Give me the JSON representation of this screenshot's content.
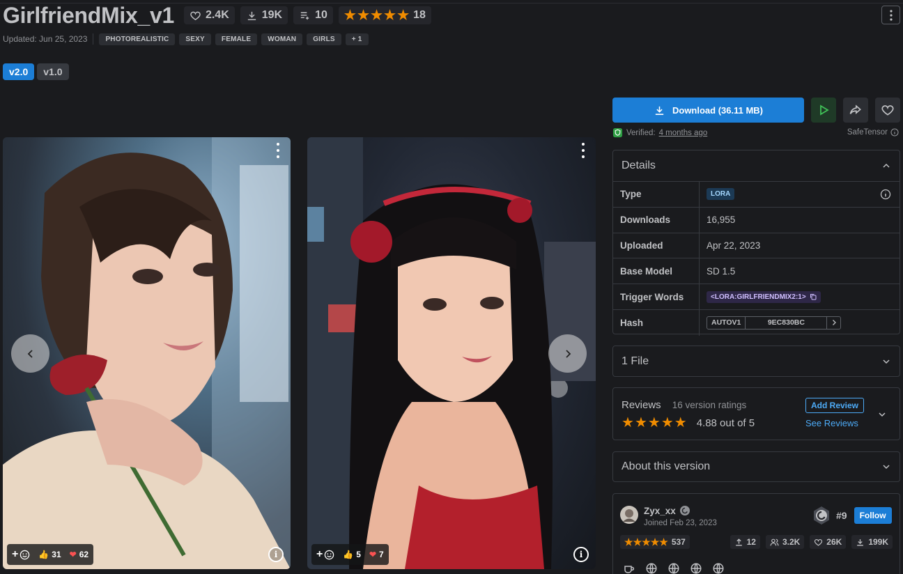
{
  "header": {
    "title": "GirlfriendMix_v1",
    "likes": "2.4K",
    "downloads": "19K",
    "collections": "10",
    "rating_count": "18"
  },
  "meta": {
    "updated": "Updated: Jun 25, 2023",
    "tags": [
      "PHOTOREALISTIC",
      "SEXY",
      "FEMALE",
      "WOMAN",
      "GIRLS"
    ],
    "more_tags": "+ 1"
  },
  "versions": [
    {
      "label": "v2.0",
      "active": true
    },
    {
      "label": "v1.0",
      "active": false
    }
  ],
  "gallery": [
    {
      "thumbs": "31",
      "hearts": "62"
    },
    {
      "thumbs": "5",
      "hearts": "7"
    }
  ],
  "download": {
    "label": "Download (36.11 MB)",
    "verified_prefix": "Verified:",
    "verified_time": "4 months ago",
    "format": "SafeTensor"
  },
  "details": {
    "title": "Details",
    "rows": [
      {
        "key": "Type",
        "value": "LORA"
      },
      {
        "key": "Downloads",
        "value": "16,955"
      },
      {
        "key": "Uploaded",
        "value": "Apr 22, 2023"
      },
      {
        "key": "Base Model",
        "value": "SD 1.5"
      },
      {
        "key": "Trigger Words",
        "value": "<LORA:GIRLFRIENDMIX2:1>"
      },
      {
        "key": "Hash",
        "value": "AUTOV1",
        "hash": "9EC830BC"
      }
    ]
  },
  "files": {
    "title": "1 File"
  },
  "reviews": {
    "title": "Reviews",
    "sub": "16 version ratings",
    "score": "4.88 out of 5",
    "add": "Add Review",
    "see": "See Reviews"
  },
  "about": {
    "title": "About this version"
  },
  "creator": {
    "name": "Zyx_xx",
    "joined": "Joined Feb 23, 2023",
    "rank": "#9",
    "follow": "Follow",
    "rating": "537",
    "uploads": "12",
    "followers": "3.2K",
    "likes": "26K",
    "downloads": "199K"
  },
  "colors": {
    "accent": "#1c7ed6",
    "star": "#f08c00",
    "bg": "#1a1b1e"
  }
}
